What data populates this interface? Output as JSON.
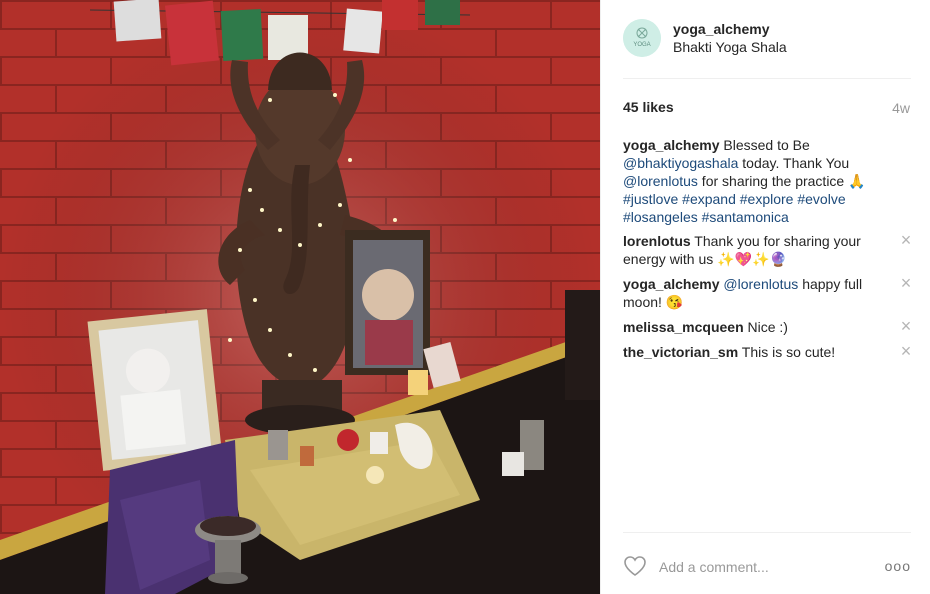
{
  "post": {
    "photo_alt": "Altar with Ganesha statue, framed portraits, candles and prayer flags against a red brick wall"
  },
  "header": {
    "username": "yoga_alchemy",
    "location": "Bhakti Yoga Shala",
    "avatar_text": "YOGA"
  },
  "stats": {
    "likes": "45 likes",
    "age": "4w"
  },
  "caption": {
    "user": "yoga_alchemy",
    "text_1": " Blessed to Be ",
    "mention_1": "@bhaktiyogashala",
    "text_2": " today. Thank You ",
    "mention_2": "@lorenlotus",
    "text_3": " for sharing the practice 🙏",
    "tags": [
      "#justlove",
      "#expand",
      "#explore",
      "#evolve",
      "#losangeles",
      "#santamonica"
    ]
  },
  "comments": [
    {
      "user": "lorenlotus",
      "text": " Thank you for sharing your energy with us ✨💖✨🔮"
    },
    {
      "user": "yoga_alchemy",
      "mention": "@lorenlotus",
      "text": " happy full moon! 😘"
    },
    {
      "user": "melissa_mcqueen",
      "text": " Nice :)"
    },
    {
      "user": "the_victorian_sm",
      "text": " This is so cute!"
    }
  ],
  "footer": {
    "comment_placeholder": "Add a comment...",
    "more_label": "ooo"
  },
  "icons": {
    "heart": "heart-icon",
    "close": "close-icon",
    "more": "more-options-icon"
  },
  "colors": {
    "link": "#1d4a7a",
    "wall": "#b3322b",
    "avatar_bg": "#cfeee6"
  }
}
